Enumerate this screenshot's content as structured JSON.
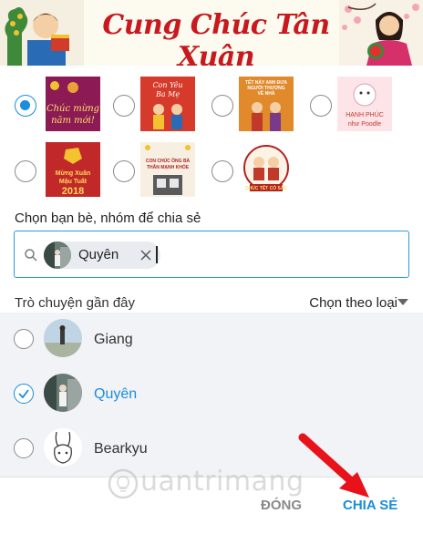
{
  "banner": {
    "title": "Cung Chúc Tân Xuân"
  },
  "cards": [
    {
      "id": "card-1",
      "selected": true,
      "lines": [
        "Chúc mừng",
        "năm mới!"
      ],
      "bg": "#8b1a55",
      "fg": "#ffe066"
    },
    {
      "id": "card-2",
      "selected": false,
      "lines": [
        "Con Yêu",
        "Ba Mẹ"
      ],
      "bg": "#d63a2a",
      "fg": "#ffffff"
    },
    {
      "id": "card-3",
      "selected": false,
      "lines": [
        "TẾT NÀY ANH ĐƯA",
        "NGƯỜI THƯƠNG",
        "VỀ NHÀ"
      ],
      "bg": "#e08a2c",
      "fg": "#ffffff"
    },
    {
      "id": "card-4",
      "selected": false,
      "lines": [
        "HẠNH PHÚC",
        "như Poodle"
      ],
      "bg": "#fde4e8",
      "fg": "#c0392b"
    },
    {
      "id": "card-5",
      "selected": false,
      "lines": [
        "Mừng Xuân",
        "Mậu Tuất",
        "2018"
      ],
      "bg": "#c0282a",
      "fg": "#ffd75a"
    },
    {
      "id": "card-6",
      "selected": false,
      "lines": [
        "CON CHÚC ÔNG BÀ",
        "THÂN MẠNH KHỎE"
      ],
      "bg": "#f6efe2",
      "fg": "#b22222"
    },
    {
      "id": "card-7",
      "selected": false,
      "lines": [
        "CHÚC TẾT CÓ SẮC"
      ],
      "bg": "#fbf3e6",
      "fg": "#a11a1a"
    }
  ],
  "share": {
    "label": "Chọn bạn bè, nhóm để chia sẻ",
    "chip_name": "Quyên"
  },
  "recent": {
    "label": "Trò chuyện gần đây",
    "filter_label": "Chọn theo loại"
  },
  "contacts": [
    {
      "name": "Giang",
      "selected": false
    },
    {
      "name": "Quyên",
      "selected": true
    },
    {
      "name": "Bearkyu",
      "selected": false
    }
  ],
  "footer": {
    "close_label": "ĐÓNG",
    "share_label": "CHIA SẺ",
    "watermark": "uantrimang"
  },
  "colors": {
    "accent": "#1a8ddb",
    "banner_red": "#c8191e",
    "arrow_red": "#e8121a"
  }
}
